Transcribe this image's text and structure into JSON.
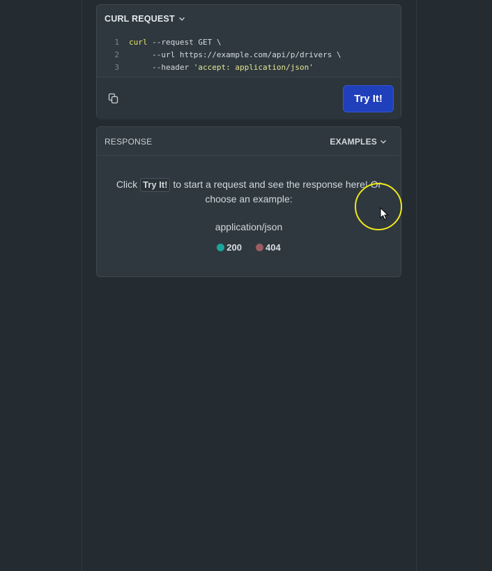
{
  "curl": {
    "title": "CURL REQUEST",
    "lines": [
      {
        "num": "1",
        "kw": "curl",
        "rest": " --request GET \\"
      },
      {
        "num": "2",
        "text": "     --url https://example.com/api/p/drivers \\"
      },
      {
        "num": "3",
        "text": "     --header ",
        "str": "'accept: application/json'"
      }
    ],
    "try_label": "Try It!"
  },
  "response": {
    "title": "RESPONSE",
    "examples_label": "EXAMPLES",
    "msg_pre": "Click ",
    "msg_kbd": "Try It!",
    "msg_post": " to start a request and see the response here! Or",
    "msg_line2": "choose an example:",
    "mime": "application/json",
    "statuses": [
      {
        "code": "200",
        "color": "#1ea59b"
      },
      {
        "code": "404",
        "color": "#9b5c62"
      }
    ]
  },
  "colors": {
    "accent": "#1f3fbb",
    "cursor_ring": "#f2ea1a"
  }
}
